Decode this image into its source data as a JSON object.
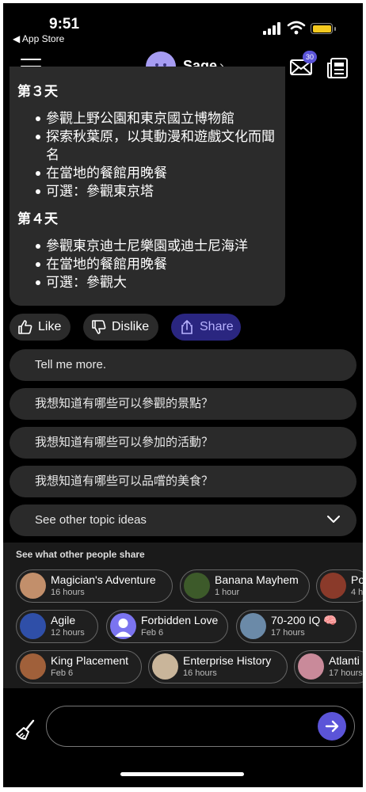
{
  "status_bar": {
    "time": "9:51",
    "back_app": "◀ App Store"
  },
  "header": {
    "bot_name": "Sage",
    "mail_badge": "30"
  },
  "message": {
    "day3": {
      "heading": "第３天",
      "items": [
        "參觀上野公園和東京國立博物館",
        "探索秋葉原，以其動漫和遊戲文化而聞名",
        "在當地的餐館用晚餐",
        "可選：參觀東京塔"
      ]
    },
    "day4": {
      "heading": "第４天",
      "items": [
        "參觀東京迪士尼樂園或迪士尼海洋",
        "在當地的餐館用晚餐",
        "可選：參觀大"
      ]
    }
  },
  "reactions": {
    "like": "Like",
    "dislike": "Dislike",
    "share": "Share"
  },
  "suggestions": [
    "Tell me more.",
    "我想知道有哪些可以參觀的景點？",
    "我想知道有哪些可以參加的活動？",
    "我想知道有哪些可以品嚐的美食？"
  ],
  "topic_ideas": "See other topic ideas",
  "shares": {
    "title": "See what other people share",
    "chips": [
      {
        "title": "Magician's Adventure",
        "sub": "16 hours"
      },
      {
        "title": "Banana Mayhem",
        "sub": "1 hour"
      },
      {
        "title": "Po",
        "sub": "4 h"
      },
      {
        "title": "Agile",
        "sub": "12 hours"
      },
      {
        "title": "Forbidden Love",
        "sub": "Feb 6"
      },
      {
        "title": "70-200 IQ 🧠",
        "sub": "17 hours"
      },
      {
        "title": "King Placement",
        "sub": "Feb 6"
      },
      {
        "title": "Enterprise History",
        "sub": "16 hours"
      },
      {
        "title": "Atlanti",
        "sub": "17 hours"
      }
    ]
  },
  "colors": {
    "accent": "#5b54d8",
    "share_bg": "#2a2680",
    "battery": "#f4c91e"
  }
}
